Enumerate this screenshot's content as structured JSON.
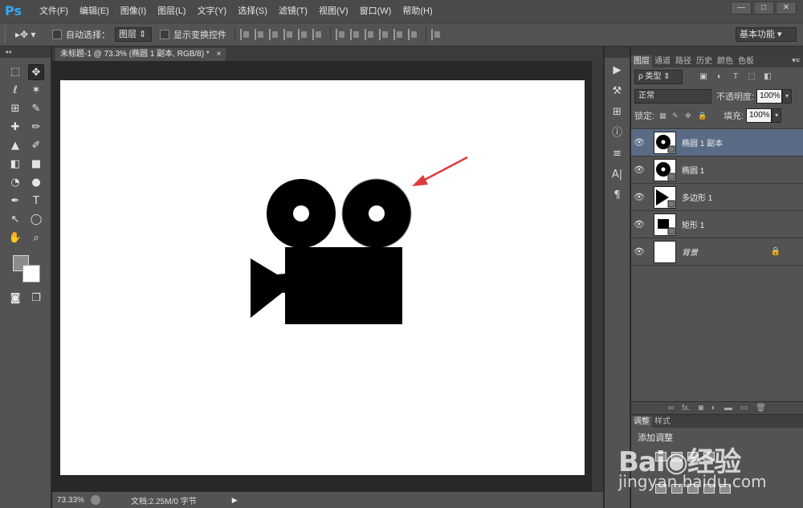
{
  "app": {
    "logo_text": "Ps",
    "window_controls": [
      "—",
      "□",
      "✕"
    ]
  },
  "menu": [
    "文件(F)",
    "编辑(E)",
    "图像(I)",
    "图层(L)",
    "文字(Y)",
    "选择(S)",
    "滤镜(T)",
    "视图(V)",
    "窗口(W)",
    "帮助(H)"
  ],
  "options_bar": {
    "tool_glyph": "▸✥ ▾",
    "auto_select_label": "自动选择：",
    "auto_select_value": "图层",
    "show_transform_label": "显示变换控件",
    "workspace": "基本功能"
  },
  "document": {
    "tab_title": "未标题-1 @ 73.3% (椭圆 1 副本, RGB/8) *",
    "tab_close": "×",
    "zoom": "73.33%",
    "doc_info": "文档:2.25M/0 字节",
    "arrow_color": "#e03a3a"
  },
  "toolbar_head": "◂◂",
  "tools": [
    [
      "⬚",
      "✥"
    ],
    [
      "ℓ",
      "✶"
    ],
    [
      "⊞",
      "✎"
    ],
    [
      "✚",
      "✏"
    ],
    [
      "▲",
      "✐"
    ],
    [
      "◧",
      "■"
    ],
    [
      "◔",
      "●"
    ],
    [
      "✒",
      "T"
    ],
    [
      "↖",
      "◯"
    ],
    [
      "✋",
      "⌕"
    ]
  ],
  "quickmask_glyphs": [
    "◙",
    "❐"
  ],
  "iconstrip": [
    "▶",
    "⚒",
    "⊞",
    "ⓘ",
    "≡",
    "A|",
    "¶"
  ],
  "layers_panel": {
    "tabs": [
      "图层",
      "通道",
      "路径",
      "历史",
      "颜色",
      "色板"
    ],
    "active_tab": "图层",
    "menu_glyph": "▾≡",
    "filter_kind": "ρ 类型",
    "filter_icons": [
      "▣",
      "◐",
      "T",
      "⬚",
      "◧"
    ],
    "blend_mode": "正常",
    "opacity_label": "不透明度:",
    "opacity_value": "100%",
    "lock_label": "锁定:",
    "lock_icons": [
      "▦",
      "✎",
      "✥",
      "🔒"
    ],
    "fill_label": "填充:",
    "fill_value": "100%",
    "dropdown_glyph": "▾",
    "eye_glyph": "👁",
    "lock_glyph": "🔒",
    "layers": [
      {
        "name": "椭圆 1 副本",
        "selected": true,
        "thumb": "circle"
      },
      {
        "name": "椭圆 1",
        "selected": false,
        "thumb": "circle"
      },
      {
        "name": "多边形 1",
        "selected": false,
        "thumb": "triangle"
      },
      {
        "name": "矩形 1",
        "selected": false,
        "thumb": "rect"
      },
      {
        "name": "背景",
        "selected": false,
        "thumb": "white",
        "locked": true
      }
    ],
    "footer_icons": [
      "∞",
      "fx.",
      "◙",
      "◐",
      "▬",
      "▭",
      "🗑"
    ]
  },
  "adjust_panel": {
    "tabs": [
      "调整",
      "样式"
    ],
    "title": "添加调整"
  },
  "watermark": {
    "main": "Bai◉经验",
    "sub": "jingyan.baidu.com"
  }
}
